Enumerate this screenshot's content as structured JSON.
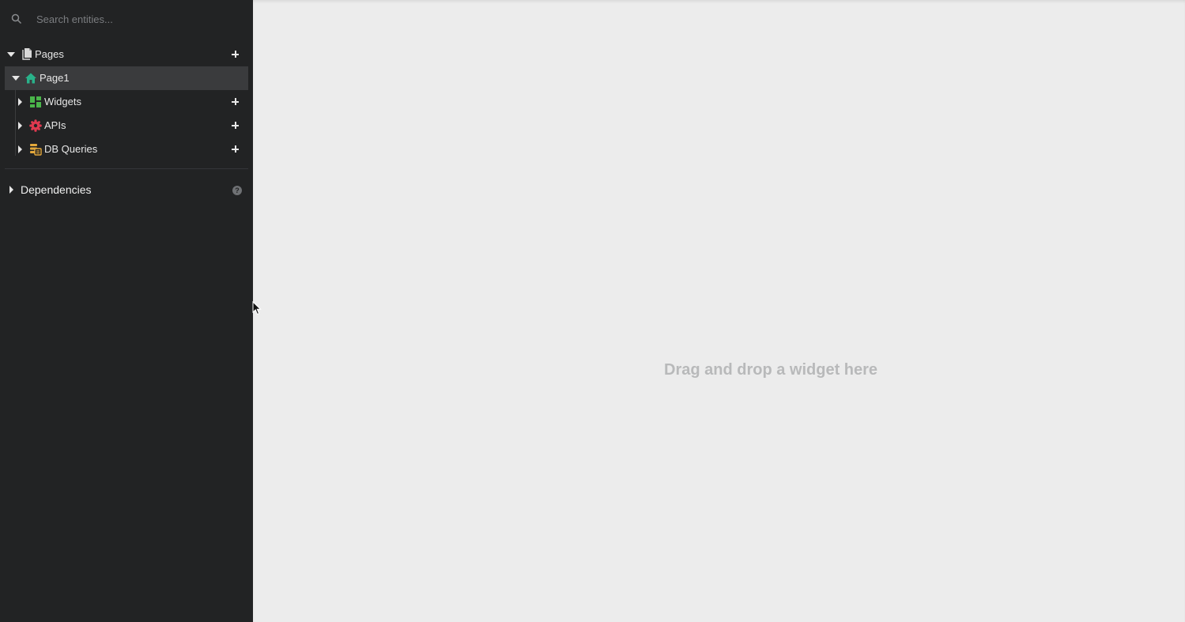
{
  "sidebar": {
    "search": {
      "placeholder": "Search entities..."
    },
    "pages": {
      "label": "Pages",
      "expanded": true
    },
    "page1": {
      "label": "Page1",
      "selected": true,
      "children": [
        {
          "label": "Widgets",
          "icon": "widgets-icon",
          "color": "#4ab54a"
        },
        {
          "label": "APIs",
          "icon": "api-icon",
          "color": "#e0394f"
        },
        {
          "label": "DB Queries",
          "icon": "db-queries-icon",
          "color": "#e3a83b"
        }
      ]
    },
    "dependencies": {
      "label": "Dependencies"
    }
  },
  "canvas": {
    "empty_hint": "Drag and drop a widget here"
  },
  "colors": {
    "sidebar_bg": "#222324",
    "selected_bg": "#3a3b3d",
    "canvas_bg": "#ececec",
    "home_icon": "#29b28a"
  }
}
